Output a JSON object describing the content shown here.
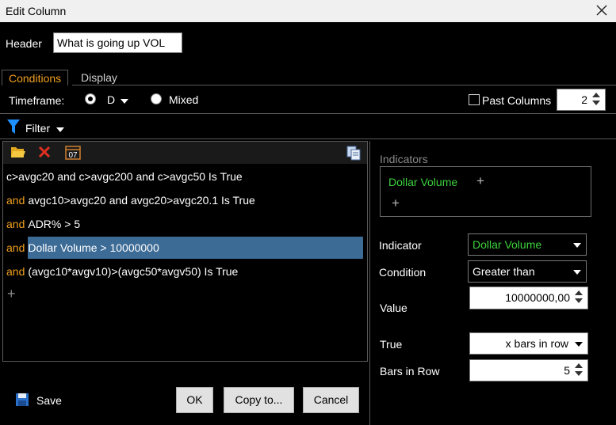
{
  "window": {
    "title": "Edit Column"
  },
  "header": {
    "label": "Header",
    "value": "What is going up VOL"
  },
  "tabs": [
    {
      "label": "Conditions",
      "active": true
    },
    {
      "label": "Display",
      "active": false
    }
  ],
  "timeframe": {
    "label": "Timeframe:",
    "selected_value": "D",
    "mixed_label": "Mixed",
    "past_columns_label": "Past Columns",
    "past_columns_value": "2"
  },
  "filter": {
    "label": "Filter"
  },
  "conditions": [
    {
      "prefix": "",
      "text": "c>avgc20 and c>avgc200 and c>avgc50 Is True",
      "selected": false
    },
    {
      "prefix": "and",
      "text": "avgc10>avgc20 and avgc20>avgc20.1 Is True",
      "selected": false
    },
    {
      "prefix": "and",
      "text": "ADR% > 5",
      "selected": false
    },
    {
      "prefix": "and",
      "text": "Dollar Volume  > 10000000",
      "selected": true
    },
    {
      "prefix": "and",
      "text": "(avgc10*avgv10)>(avgc50*avgv50)  Is True",
      "selected": false
    }
  ],
  "add_condition_symbol": "+",
  "buttons": {
    "save": "Save",
    "ok": "OK",
    "copy_to": "Copy to...",
    "cancel": "Cancel"
  },
  "right": {
    "indicators_label": "Indicators",
    "indicator_item": "Dollar Volume",
    "plus": "+",
    "indicator_label": "Indicator",
    "indicator_value": "Dollar Volume",
    "condition_label": "Condition",
    "condition_value": "Greater than",
    "value_label": "Value",
    "value_value": "10000000,00",
    "true_label": "True",
    "true_value": "x bars in row",
    "bars_in_row_label": "Bars in Row",
    "bars_in_row_value": "5"
  },
  "colors": {
    "accent_orange": "#f0a020",
    "indicator_green": "#3cd23c",
    "selection_blue": "#3c6b96",
    "filter_icon_blue": "#1e90ff"
  },
  "icons": [
    "close-icon",
    "filter-funnel-icon",
    "folder-open-icon",
    "delete-x-icon",
    "calendar-07-icon",
    "copy-clipboard-icon",
    "save-floppy-icon"
  ]
}
